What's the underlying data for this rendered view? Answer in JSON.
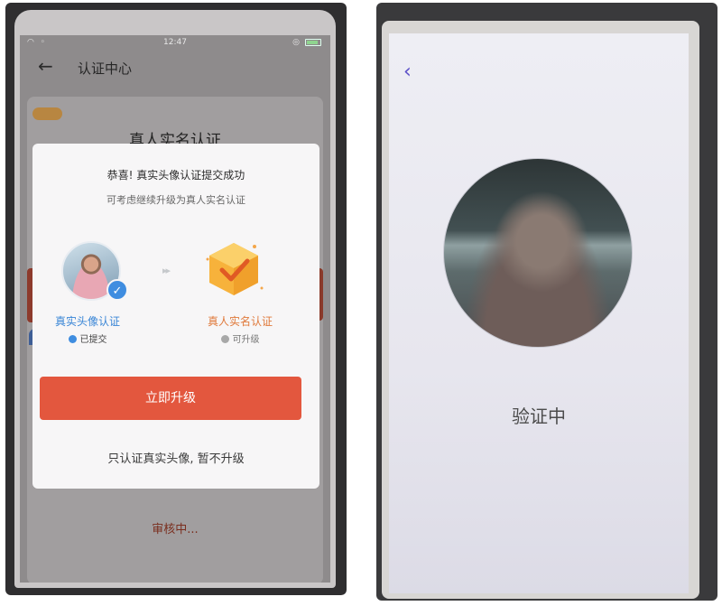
{
  "left_screen": {
    "status_time": "12:47",
    "header_title": "认证中心",
    "background": {
      "title": "真人实名认证",
      "review_text": "审核中..."
    },
    "modal": {
      "title": "恭喜! 真实头像认证提交成功",
      "subtitle": "可考虑继续升级为真人实名认证",
      "step_left_label": "真实头像认证",
      "step_left_status": "已提交",
      "step_right_label": "真人实名认证",
      "step_right_status": "可升级",
      "upgrade_button": "立即升级",
      "skip_link": "只认证真实头像, 暂不升级"
    }
  },
  "right_screen": {
    "status_text": "验证中"
  },
  "colors": {
    "accent_red": "#e3573e",
    "verified_blue": "#3f8de0",
    "upgrade_orange": "#e07a3c",
    "back_purple": "#5a4ec7"
  },
  "icons": [
    "wifi-icon",
    "location-icon",
    "battery-icon",
    "back-arrow-icon",
    "verified-check-icon",
    "double-arrow-icon",
    "hexagon-check-icon",
    "back-chevron-icon"
  ]
}
